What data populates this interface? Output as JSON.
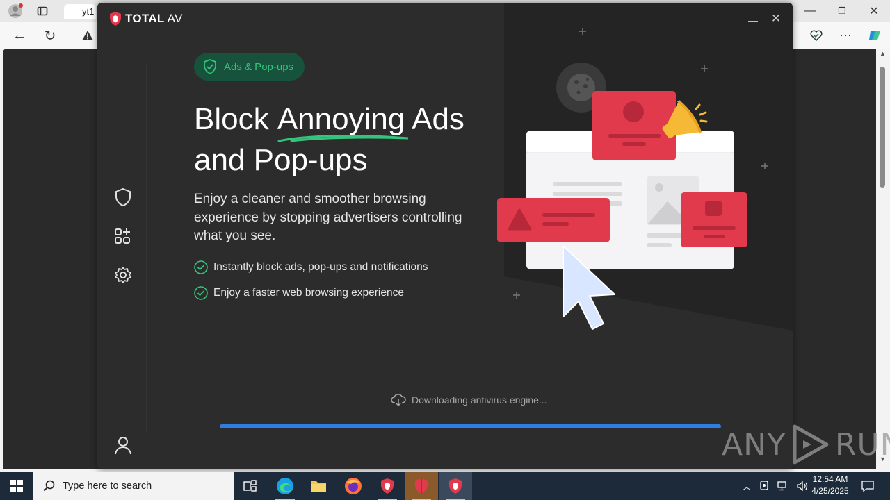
{
  "browser": {
    "tab_title": "yt1",
    "scrollbar_up": "▲",
    "scrollbar_down": "▼"
  },
  "app": {
    "logo_brand": "TOTAL",
    "logo_suffix": "AV",
    "minimize": "—",
    "close": "✕"
  },
  "sidebar": {
    "items": [
      {
        "name": "shield-icon"
      },
      {
        "name": "apps-add-icon"
      },
      {
        "name": "gear-icon"
      },
      {
        "name": "user-icon"
      }
    ]
  },
  "feature": {
    "pill_label": "Ads & Pop-ups",
    "headline_part1": "Block ",
    "headline_highlight": "Annoying",
    "headline_part2": " Ads and Pop-ups",
    "description": "Enjoy a cleaner and smoother browsing experience by stopping advertisers controlling what you see.",
    "bullets": [
      "Instantly block ads, pop-ups and notifications",
      "Enjoy a faster web browsing experience"
    ]
  },
  "download": {
    "status_text": "Downloading antivirus engine...",
    "progress": 1.0
  },
  "watermark": {
    "left": "ANY",
    "right": "RUN"
  },
  "taskbar": {
    "search_placeholder": "Type here to search",
    "time": "12:54 AM",
    "date": "4/25/2025"
  },
  "colors": {
    "accent_green": "#34c47c",
    "pill_bg": "#17523c",
    "progress_blue": "#2f7de1",
    "ad_red": "#e23a4d",
    "megaphone_yellow": "#f5b935"
  }
}
